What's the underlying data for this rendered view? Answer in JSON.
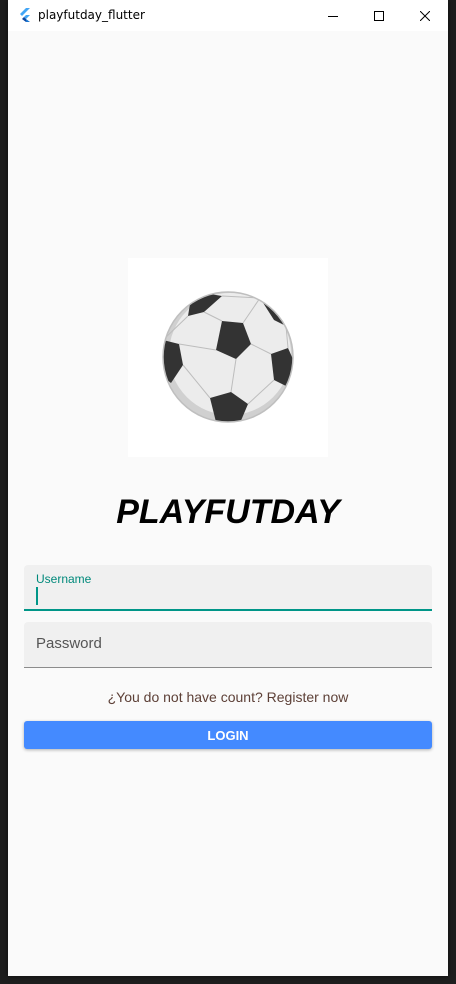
{
  "window": {
    "title": "playfutday_flutter"
  },
  "app": {
    "title": "PLAYFUTDAY",
    "logo_icon": "soccer-ball-icon"
  },
  "form": {
    "username": {
      "label": "Username",
      "value": ""
    },
    "password": {
      "placeholder": "Password",
      "value": ""
    },
    "register_text": "¿You do not have count? Register now",
    "login_label": "LOGIN"
  },
  "colors": {
    "accent": "#009688",
    "button": "#448aff",
    "link": "#5d4037"
  }
}
